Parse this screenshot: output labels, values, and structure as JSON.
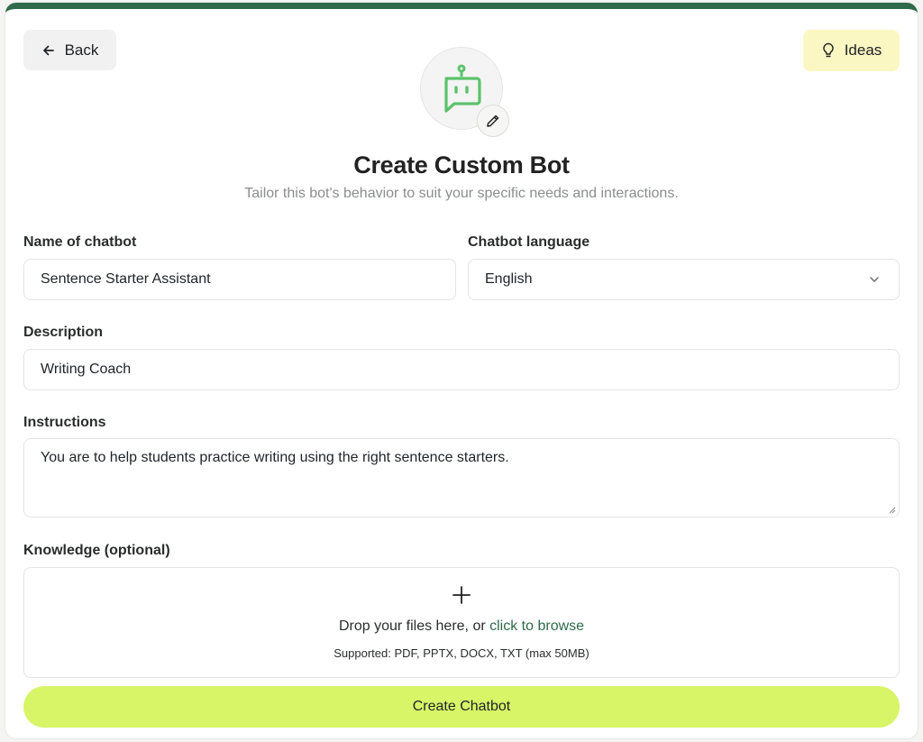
{
  "header": {
    "back_label": "Back",
    "ideas_label": "Ideas"
  },
  "hero": {
    "title": "Create Custom Bot",
    "subtitle": "Tailor this bot's behavior to suit your specific needs and interactions."
  },
  "form": {
    "name_label": "Name of chatbot",
    "name_value": "Sentence Starter Assistant",
    "language_label": "Chatbot language",
    "language_value": "English",
    "description_label": "Description",
    "description_value": "Writing Coach",
    "instructions_label": "Instructions",
    "instructions_value": "You are to help students practice writing using the right sentence starters.",
    "knowledge_label": "Knowledge (optional)",
    "dropzone_text": "Drop your files here, or ",
    "dropzone_link": "click to browse",
    "dropzone_supported": "Supported: PDF, PPTX, DOCX, TXT (max 50MB)",
    "submit_label": "Create Chatbot"
  },
  "icons": {
    "back": "arrow-left-icon",
    "ideas": "lightbulb-icon",
    "avatar": "chatbot-icon",
    "edit": "pencil-icon",
    "select": "chevron-down-icon",
    "upload": "plus-icon"
  },
  "colors": {
    "top_border": "#2f6a4a",
    "accent_button": "#d7f567",
    "ideas_button": "#fbf7c3",
    "bot_icon": "#5cc36b",
    "link": "#2f6a4a"
  }
}
